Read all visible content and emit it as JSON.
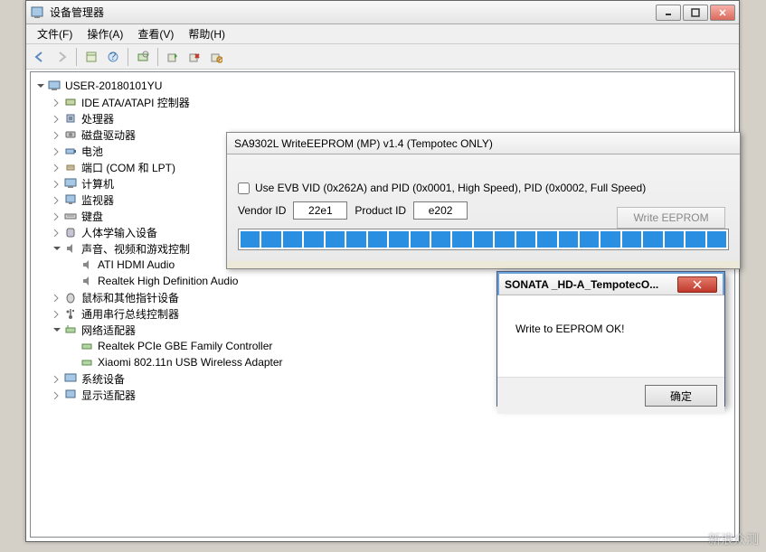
{
  "main": {
    "title": "设备管理器",
    "menus": {
      "file": "文件(F)",
      "action": "操作(A)",
      "view": "查看(V)",
      "help": "帮助(H)"
    }
  },
  "tree": {
    "root": "USER-20180101YU",
    "ide": "IDE ATA/ATAPI 控制器",
    "processor": "处理器",
    "disk": "磁盘驱动器",
    "battery": "电池",
    "port": "端口 (COM 和 LPT)",
    "computer": "计算机",
    "monitor": "监视器",
    "keyboard": "键盘",
    "hid": "人体学输入设备",
    "sound": "声音、视频和游戏控制",
    "ati": "ATI HDMI Audio",
    "realtek_audio": "Realtek High Definition Audio",
    "mouse": "鼠标和其他指针设备",
    "usb": "通用串行总线控制器",
    "network": "网络适配器",
    "realtek_pcie": "Realtek PCIe GBE Family Controller",
    "xiaomi": "Xiaomi 802.11n USB Wireless Adapter",
    "system": "系统设备",
    "display": "显示适配器"
  },
  "eeprom": {
    "title": "SA9302L WriteEEPROM (MP) v1.4 (Tempotec ONLY)",
    "checkbox_label": "Use EVB VID (0x262A) and PID (0x0001, High Speed), PID (0x0002, Full Speed)",
    "vendor_label": "Vendor ID",
    "vendor_value": "22e1",
    "product_label": "Product ID",
    "product_value": "e202",
    "write_button": "Write EEPROM"
  },
  "msgbox": {
    "title": "SONATA _HD-A_TempotecO...",
    "message": "Write to EEPROM OK!",
    "ok": "确定"
  },
  "watermark": "新浪众测"
}
